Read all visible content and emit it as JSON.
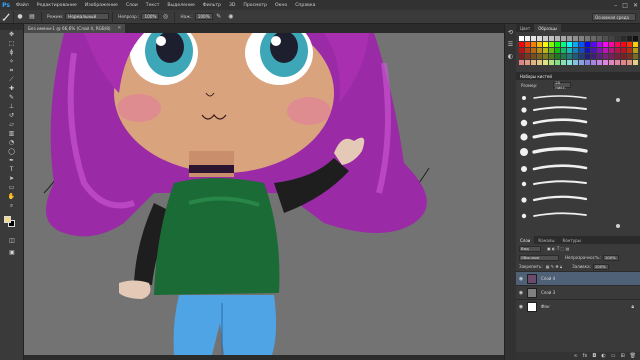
{
  "app": {
    "logo": "Ps"
  },
  "menu": [
    "Файл",
    "Редактирование",
    "Изображение",
    "Слои",
    "Текст",
    "Выделение",
    "Фильтр",
    "3D",
    "Просмотр",
    "Окно",
    "Справка"
  ],
  "window_controls": [
    "–",
    "□",
    "✕"
  ],
  "options": {
    "mode_label": "Режим:",
    "mode_value": "Нормальный",
    "opacity_label": "Непрозр.:",
    "opacity_value": "100%",
    "flow_label": "Наж.:",
    "flow_value": "100%",
    "workspace": "Основная среда"
  },
  "document": {
    "tab_title": "Без имени-1 @ 66,6% (Слой 4, RGB/8)"
  },
  "panels": {
    "swatches_tabs": [
      "Цвет",
      "Образцы"
    ],
    "brush_tabs": [
      "Наборы кистей"
    ],
    "brush_size_label": "Размер:",
    "brush_size_value": "25 пикс.",
    "layers_tabs": [
      "Слои",
      "Каналы",
      "Контуры"
    ],
    "layer_filter": "Вид",
    "blend_mode": "Обычные",
    "opacity_label": "Непрозрачность:",
    "opacity_value": "100%",
    "lock_label": "Закрепить:",
    "fill_label": "Заливка:",
    "fill_value": "100%",
    "layers": [
      {
        "name": "Слой 4",
        "active": true,
        "thumb": "#6b4a6b"
      },
      {
        "name": "Слой 3",
        "active": false,
        "thumb": "#808080"
      },
      {
        "name": "Фон",
        "active": false,
        "thumb": "#ffffff"
      }
    ]
  },
  "colors": {
    "foreground": "#f1d98c",
    "background": "#000000",
    "canvas_bg": "#737373",
    "hair": "#a82fb0",
    "skin": "#d9a37e",
    "sweater": "#1a6b35",
    "jeans": "#4fa4e6",
    "eyes": "#3da7b8",
    "active_layer": "#4f6177"
  }
}
